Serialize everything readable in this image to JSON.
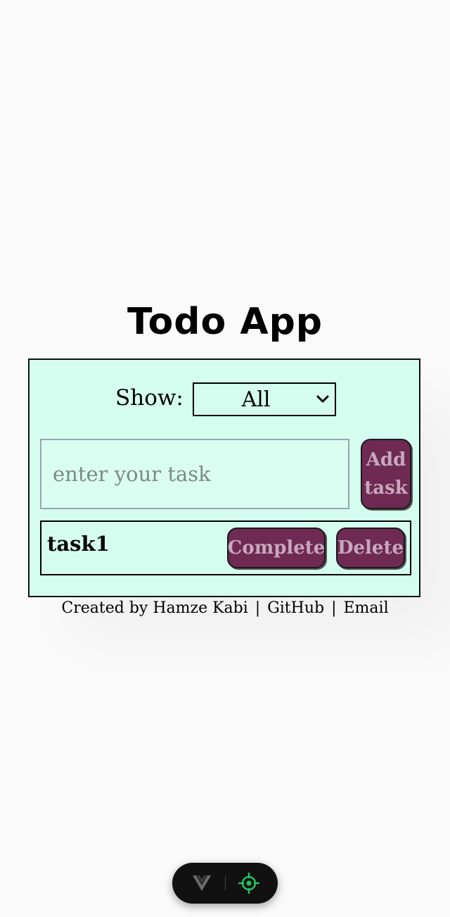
{
  "app": {
    "title": "Todo App"
  },
  "filter": {
    "label": "Show:",
    "selected": "All"
  },
  "new_task": {
    "placeholder": "enter your task",
    "value": "",
    "add_label": "Add\ntask"
  },
  "tasks": [
    {
      "text": "task1",
      "complete_label": "Complete",
      "delete_label": "Delete"
    }
  ],
  "footer": {
    "credit": "Created by Hamze Kabi",
    "sep1": "|",
    "github": "GitHub",
    "sep2": "|",
    "email": "Email"
  },
  "dev_toolbar": {
    "icons": [
      "vue-logo-icon",
      "crosshair-inspect-icon"
    ]
  },
  "colors": {
    "page_bg": "#fafafa",
    "card_bg": "#d4fdef",
    "button_bg": "#6f2a53",
    "button_text": "#c7a8bc",
    "inspect_icon": "#22c55e"
  }
}
